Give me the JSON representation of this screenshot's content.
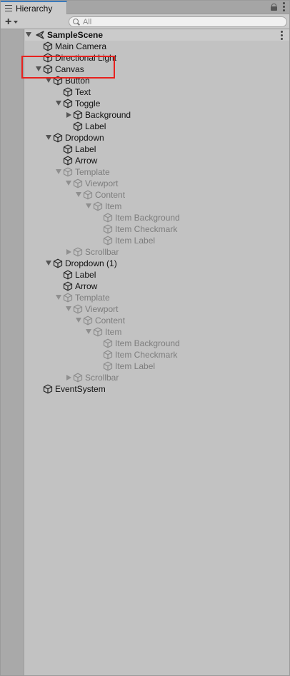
{
  "panel": {
    "tab_title": "Hierarchy",
    "search_placeholder": "All"
  },
  "colors": {
    "highlight": "#e8211d",
    "tab_accent": "#3a79bb"
  },
  "tree": [
    {
      "label": "SampleScene",
      "depth": 0,
      "expander": "down",
      "icon": "unity-scene-icon",
      "disabled": false,
      "bold": true
    },
    {
      "label": "Main Camera",
      "depth": 1,
      "expander": null,
      "icon": "gameobject-cube-icon",
      "disabled": false
    },
    {
      "label": "Directional Light",
      "depth": 1,
      "expander": null,
      "icon": "gameobject-cube-icon",
      "disabled": false
    },
    {
      "label": "Canvas",
      "depth": 1,
      "expander": "down",
      "icon": "gameobject-cube-icon",
      "disabled": false
    },
    {
      "label": "Button",
      "depth": 2,
      "expander": "down",
      "icon": "gameobject-cube-icon",
      "disabled": false
    },
    {
      "label": "Text",
      "depth": 3,
      "expander": null,
      "icon": "gameobject-cube-icon",
      "disabled": false
    },
    {
      "label": "Toggle",
      "depth": 3,
      "expander": "down",
      "icon": "gameobject-cube-icon",
      "disabled": false
    },
    {
      "label": "Background",
      "depth": 4,
      "expander": "right",
      "icon": "gameobject-cube-icon",
      "disabled": false
    },
    {
      "label": "Label",
      "depth": 4,
      "expander": null,
      "icon": "gameobject-cube-icon",
      "disabled": false
    },
    {
      "label": "Dropdown",
      "depth": 2,
      "expander": "down",
      "icon": "gameobject-cube-icon",
      "disabled": false
    },
    {
      "label": "Label",
      "depth": 3,
      "expander": null,
      "icon": "gameobject-cube-icon",
      "disabled": false
    },
    {
      "label": "Arrow",
      "depth": 3,
      "expander": null,
      "icon": "gameobject-cube-icon",
      "disabled": false
    },
    {
      "label": "Template",
      "depth": 3,
      "expander": "down",
      "icon": "gameobject-cube-icon",
      "disabled": true
    },
    {
      "label": "Viewport",
      "depth": 4,
      "expander": "down",
      "icon": "gameobject-cube-icon",
      "disabled": true
    },
    {
      "label": "Content",
      "depth": 5,
      "expander": "down",
      "icon": "gameobject-cube-icon",
      "disabled": true
    },
    {
      "label": "Item",
      "depth": 6,
      "expander": "down",
      "icon": "gameobject-cube-icon",
      "disabled": true
    },
    {
      "label": "Item Background",
      "depth": 7,
      "expander": null,
      "icon": "gameobject-cube-icon",
      "disabled": true
    },
    {
      "label": "Item Checkmark",
      "depth": 7,
      "expander": null,
      "icon": "gameobject-cube-icon",
      "disabled": true
    },
    {
      "label": "Item Label",
      "depth": 7,
      "expander": null,
      "icon": "gameobject-cube-icon",
      "disabled": true
    },
    {
      "label": "Scrollbar",
      "depth": 4,
      "expander": "right",
      "icon": "gameobject-cube-icon",
      "disabled": true
    },
    {
      "label": "Dropdown (1)",
      "depth": 2,
      "expander": "down",
      "icon": "gameobject-cube-icon",
      "disabled": false
    },
    {
      "label": "Label",
      "depth": 3,
      "expander": null,
      "icon": "gameobject-cube-icon",
      "disabled": false
    },
    {
      "label": "Arrow",
      "depth": 3,
      "expander": null,
      "icon": "gameobject-cube-icon",
      "disabled": false
    },
    {
      "label": "Template",
      "depth": 3,
      "expander": "down",
      "icon": "gameobject-cube-icon",
      "disabled": true
    },
    {
      "label": "Viewport",
      "depth": 4,
      "expander": "down",
      "icon": "gameobject-cube-icon",
      "disabled": true
    },
    {
      "label": "Content",
      "depth": 5,
      "expander": "down",
      "icon": "gameobject-cube-icon",
      "disabled": true
    },
    {
      "label": "Item",
      "depth": 6,
      "expander": "down",
      "icon": "gameobject-cube-icon",
      "disabled": true
    },
    {
      "label": "Item Background",
      "depth": 7,
      "expander": null,
      "icon": "gameobject-cube-icon",
      "disabled": true
    },
    {
      "label": "Item Checkmark",
      "depth": 7,
      "expander": null,
      "icon": "gameobject-cube-icon",
      "disabled": true
    },
    {
      "label": "Item Label",
      "depth": 7,
      "expander": null,
      "icon": "gameobject-cube-icon",
      "disabled": true
    },
    {
      "label": "Scrollbar",
      "depth": 4,
      "expander": "right",
      "icon": "gameobject-cube-icon",
      "disabled": true
    },
    {
      "label": "EventSystem",
      "depth": 1,
      "expander": null,
      "icon": "gameobject-cube-icon",
      "disabled": false
    }
  ]
}
